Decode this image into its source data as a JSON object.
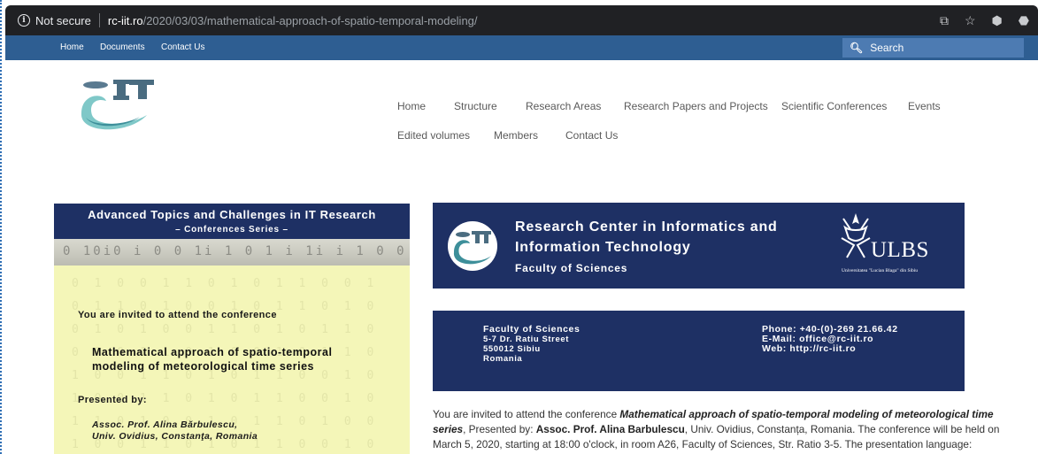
{
  "browser": {
    "not_secure": "Not secure",
    "host": "rc-iit.ro",
    "path": "/2020/03/03/mathematical-approach-of-spatio-temporal-modeling/"
  },
  "topnav": {
    "home": "Home",
    "documents": "Documents",
    "contact": "Contact Us",
    "search_label": "Search"
  },
  "mainnav": {
    "items": [
      "Home",
      "Structure",
      "Research Areas",
      "Research Papers and Projects",
      "Scientific Conferences",
      "Events",
      "Edited volumes",
      "Members",
      "Contact Us"
    ]
  },
  "poster": {
    "title": "Advanced Topics and Challenges in IT Research",
    "subtitle": "– Conferences Series –",
    "band_text": "0  10i0 i 0 0 1i  1  0  1 i 1i  i  1 0 0 i",
    "bits": "0 1 0 0 1 1 0 1 0 1 1 0 0 1 0 1 1 0 1 0 0 1 0 1 1 0 1 0 0 1 0 1 0 0 1 1 0 1 0 1 1 0 0 1 0 1 1 0 1 0 0 1 0 1 1 0 1 0 0 1 1 0 1 0 1 1 0 0 1 0 1 0 0 1 1 0 1 0 1 1 0 0 1 0 1 1 0 1 0 0 1 0 1 1 0 1 0 0 1 0 0 1 1 0 1 0 1 1 0 0 1 0 1 1 0 1 0 0 1 0 1 1 0 1 0",
    "invite": "You are invited  to attend  the conference",
    "conf_line1": "Mathematical approach of spatio-temporal",
    "conf_line2": "modeling of meteorological time series",
    "presented_by": "Presented by:",
    "speaker_line1": "Assoc. Prof. Alina Bărbulescu,",
    "speaker_line2": "Univ. Ovidius, Constanţa, Romania"
  },
  "banner": {
    "line1": "Research Center in Informatics and",
    "line2": "Information Technology",
    "line3": "Faculty of Sciences",
    "ulbs": "ULBS",
    "ulbs_caption": "Universitatea \"Lucian Blaga\" din Sibiu"
  },
  "contact": {
    "faculty": "Faculty of Sciences",
    "street": "5-7 Dr. Ratiu Street",
    "city": "550012 Sibiu",
    "country": "Romania",
    "phone": "Phone: +40-(0)-269 21.66.42",
    "email": "E-Mail: office@rc-iit.ro",
    "web": "Web: http://rc-iit.ro"
  },
  "paragraph": {
    "p1": "You are invited to attend the conference ",
    "conf_title": "Mathematical approach of spatio-temporal modeling of meteorological time series",
    "p2": ", Presented by: ",
    "speaker": "Assoc. Prof. Alina Barbulescu",
    "p3": ", Univ. Ovidius, Constanța, Romania. The conference will be held on March 5, 2020, starting at 18:00 o'clock, in room A26, Faculty of Sciences, Str. Ratio 3-5. The presentation language:"
  },
  "colors": {
    "navy": "#1e3064",
    "topnav": "#2e5e92",
    "poster_bg": "#f4f6b8"
  }
}
